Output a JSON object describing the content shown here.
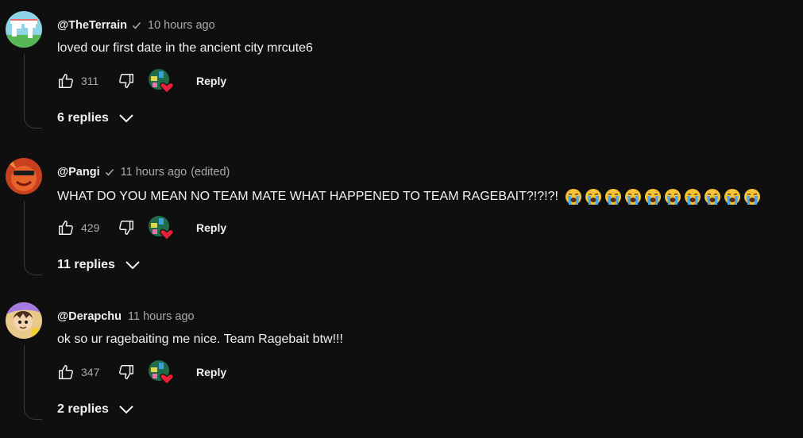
{
  "comments": [
    {
      "handle": "@TheTerrain",
      "verified": true,
      "time": "10 hours ago",
      "edited": "",
      "text": "loved our first date in the ancient city mrcute6",
      "emoji_count": 0,
      "likes": "311",
      "reply_label": "Reply",
      "replies_label": "6 replies"
    },
    {
      "handle": "@Pangi",
      "verified": true,
      "time": "11 hours ago",
      "edited": "(edited)",
      "text": "WHAT DO YOU MEAN NO TEAM MATE WHAT HAPPENED TO TEAM RAGEBAIT?!?!?!",
      "emoji_count": 10,
      "emoji_name": "loudly-crying-face-emoji",
      "likes": "429",
      "reply_label": "Reply",
      "replies_label": "11 replies"
    },
    {
      "handle": "@Derapchu",
      "verified": false,
      "time": "11 hours ago",
      "edited": "",
      "text": "ok so ur ragebaiting me nice. Team Ragebait btw!!!",
      "emoji_count": 0,
      "likes": "347",
      "reply_label": "Reply",
      "replies_label": "2 replies"
    }
  ],
  "icons": {
    "like": "thumbs-up-icon",
    "dislike": "thumbs-down-icon",
    "heart": "creator-heart-icon",
    "chevron": "chevron-down-icon",
    "verified": "verified-check-icon"
  },
  "colors": {
    "background": "#0f0f10",
    "text": "#f1f1f1",
    "secondary": "#aaaaaa",
    "heart": "#e8203a"
  }
}
